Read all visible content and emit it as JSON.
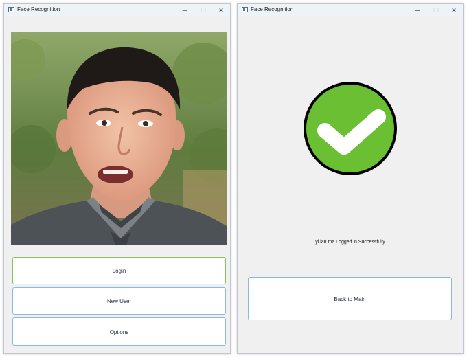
{
  "left_window": {
    "title": "Face Recognition",
    "controls": {
      "minimize": "─",
      "maximize": "☐",
      "close": "✕"
    },
    "photo_description": "",
    "buttons": {
      "login": "Login",
      "new_user": "New User",
      "options": "Options"
    }
  },
  "right_window": {
    "title": "Face Recognition",
    "controls": {
      "minimize": "─",
      "maximize": "☐",
      "close": "✕"
    },
    "status_message": "yi lan ma Logged in Successfully",
    "back_button": "Back to Main"
  },
  "colors": {
    "success_green": "#6abf32",
    "button_border": "#8cb8e8",
    "focus_border": "#86c45b"
  },
  "icons": {
    "window_icon": "app-window-icon",
    "success": "checkmark-circle-icon"
  }
}
